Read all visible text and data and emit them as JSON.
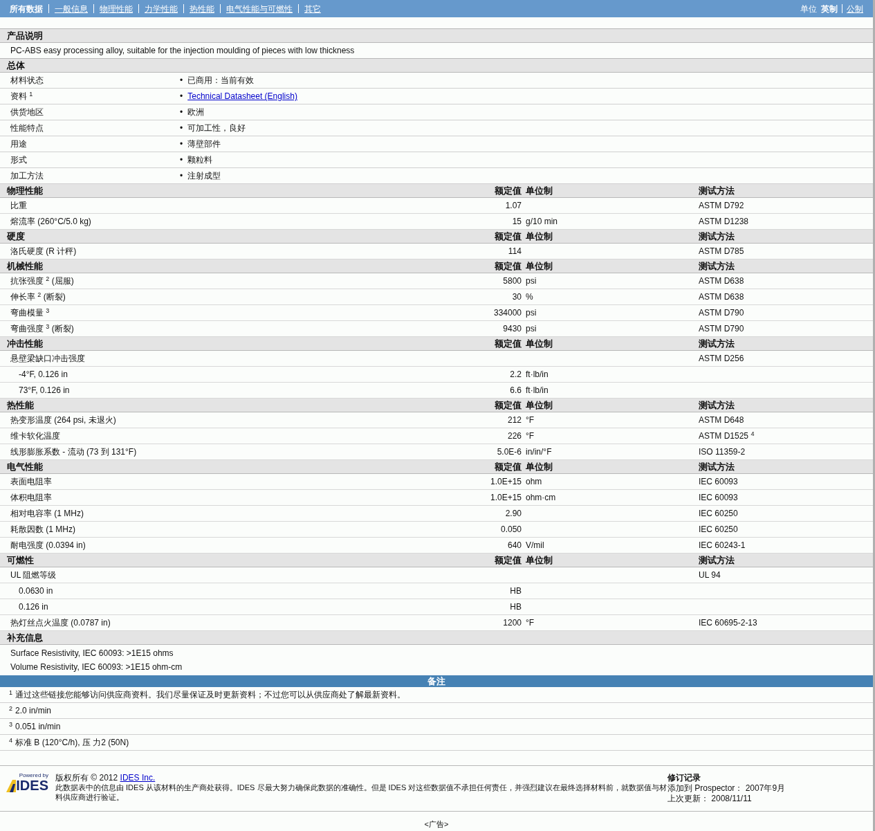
{
  "nav": {
    "items": [
      {
        "label": "所有数据",
        "selected": true
      },
      {
        "label": "一般信息",
        "selected": false
      },
      {
        "label": "物理性能",
        "selected": false
      },
      {
        "label": "力学性能",
        "selected": false
      },
      {
        "label": "热性能",
        "selected": false
      },
      {
        "label": "电气性能与可燃性",
        "selected": false
      },
      {
        "label": "其它",
        "selected": false
      }
    ],
    "units_label": "单位",
    "units": [
      {
        "label": "英制",
        "selected": true
      },
      {
        "label": "公制",
        "selected": false
      }
    ]
  },
  "description": {
    "heading": "产品说明",
    "text": "PC-ABS easy processing alloy, suitable for the injection moulding of pieces with low thickness"
  },
  "general": {
    "heading": "总体",
    "rows": [
      {
        "label": "材料状态",
        "marker": "•",
        "value": "已商用：当前有效",
        "kind": "text"
      },
      {
        "label": "资料 $^{1}$",
        "marker": "•",
        "value": "Technical Datasheet (English)",
        "kind": "link"
      },
      {
        "label": "供货地区",
        "marker": "•",
        "value": "欧洲",
        "kind": "text"
      },
      {
        "label": "性能特点",
        "marker": "•",
        "value": "可加工性，良好",
        "kind": "text"
      },
      {
        "label": "用途",
        "marker": "•",
        "value": "薄壁部件",
        "kind": "text"
      },
      {
        "label": "形式",
        "marker": "•",
        "value": "颗粒料",
        "kind": "text"
      },
      {
        "label": "加工方法",
        "marker": "•",
        "value": "注射成型",
        "kind": "text"
      }
    ]
  },
  "sections": [
    {
      "heading": "物理性能",
      "columns": [
        "额定值",
        "单位制",
        "测试方法"
      ],
      "rows": [
        {
          "label": "比重",
          "value": "1.07",
          "method": "ASTM D792"
        },
        {
          "label": "熔流率 (260°C/5.0 kg)",
          "value": "15",
          "unit": "g/10 min",
          "method": "ASTM D1238"
        }
      ]
    },
    {
      "heading": "硬度",
      "columns": [
        "额定值",
        "单位制",
        "测试方法"
      ],
      "rows": [
        {
          "label": "洛氏硬度 (R 计秤)",
          "value": "114",
          "method": "ASTM D785"
        }
      ]
    },
    {
      "heading": "机械性能",
      "columns": [
        "额定值",
        "单位制",
        "测试方法"
      ],
      "rows": [
        {
          "label": "抗张强度 $^{2}$ (屈服)",
          "value": "5800",
          "unit": "psi",
          "method": "ASTM D638"
        },
        {
          "label": "伸长率 $^{2}$ (断裂)",
          "value": "30",
          "unit": "%",
          "method": "ASTM D638"
        },
        {
          "label": "弯曲模量 $^{3}$",
          "value": "334000",
          "unit": "psi",
          "method": "ASTM D790"
        },
        {
          "label": "弯曲强度 $^{3}$ (断裂)",
          "value": "9430",
          "unit": "psi",
          "method": "ASTM D790"
        }
      ]
    },
    {
      "heading": "冲击性能",
      "columns": [
        "额定值",
        "单位制",
        "测试方法"
      ],
      "rows": [
        {
          "label": "悬壁梁缺口冲击强度",
          "method": "ASTM D256",
          "children": [
            {
              "label": "-4°F, 0.126 in",
              "value": "2.2",
              "unit": "ft·lb/in"
            },
            {
              "label": "73°F, 0.126 in",
              "value": "6.6",
              "unit": "ft·lb/in"
            }
          ]
        }
      ]
    },
    {
      "heading": "热性能",
      "columns": [
        "额定值",
        "单位制",
        "测试方法"
      ],
      "rows": [
        {
          "label": "热变形温度 (264 psi, 未退火)",
          "value": "212",
          "unit": "°F",
          "method": "ASTM D648"
        },
        {
          "label": "维卡软化温度",
          "value": "226",
          "unit": "°F",
          "method": "ASTM D1525 $^{4}$"
        },
        {
          "label": "线形膨胀系数 - 流动 (73 到 131°F)",
          "value": "5.0E-6",
          "unit": "in/in/°F",
          "method": "ISO 11359-2"
        }
      ]
    },
    {
      "heading": "电气性能",
      "columns": [
        "额定值",
        "单位制",
        "测试方法"
      ],
      "rows": [
        {
          "label": "表面电阻率",
          "value": "1.0E+15",
          "unit": "ohm",
          "method": "IEC 60093"
        },
        {
          "label": "体积电阻率",
          "value": "1.0E+15",
          "unit": "ohm·cm",
          "method": "IEC 60093"
        },
        {
          "label": "相对电容率 (1 MHz)",
          "value": "2.90",
          "method": "IEC 60250"
        },
        {
          "label": "耗散因数 (1 MHz)",
          "value": "0.050",
          "method": "IEC 60250"
        },
        {
          "label": "耐电强度 (0.0394 in)",
          "value": "640",
          "unit": "V/mil",
          "method": "IEC 60243-1"
        }
      ]
    },
    {
      "heading": "可燃性",
      "columns": [
        "额定值",
        "单位制",
        "测试方法"
      ],
      "rows": [
        {
          "label": "UL 阻燃等级",
          "method": "UL 94",
          "children": [
            {
              "label": "0.0630 in",
              "value": "HB"
            },
            {
              "label": "0.126 in",
              "value": "HB"
            }
          ]
        },
        {
          "label": "热灯丝点火温度 (0.0787 in)",
          "value": "1200",
          "unit": "°F",
          "method": "IEC 60695-2-13"
        }
      ]
    }
  ],
  "supplementary": {
    "heading": "补充信息",
    "lines": [
      "Surface Resistivity, IEC 60093: >1E15 ohms",
      "Volume Resistivity, IEC 60093: >1E15 ohm-cm"
    ]
  },
  "notes": {
    "heading": "备注",
    "items": [
      {
        "mark": "1",
        "text": "通过这些链接您能够访问供应商资料。我们尽量保证及时更新资料；不过您可以从供应商处了解最新资料。"
      },
      {
        "mark": "2",
        "text": "2.0 in/min"
      },
      {
        "mark": "3",
        "text": "0.051 in/min"
      },
      {
        "mark": "4",
        "text": "标准 B (120°C/h), 压 力2 (50N)"
      }
    ]
  },
  "footer": {
    "logo_top": "Powered by",
    "logo_name": "IDES",
    "copyright": "版权所有 © 2012",
    "company": "IDES Inc.",
    "disclaimer": "此数据表中的信息由 IDES 从该材料的生产商处获得。IDES 尽最大努力确保此数据的准确性。但是 IDES 对这些数据值不承担任何责任，并强烈建议在最终选择材料前，就数据值与材料供应商进行验证。",
    "revision_heading": "修订记录",
    "revision_lines": [
      "添加到 Prospector： 2007年9月",
      "上次更新： 2008/11/11"
    ]
  },
  "ad": "<广告>"
}
